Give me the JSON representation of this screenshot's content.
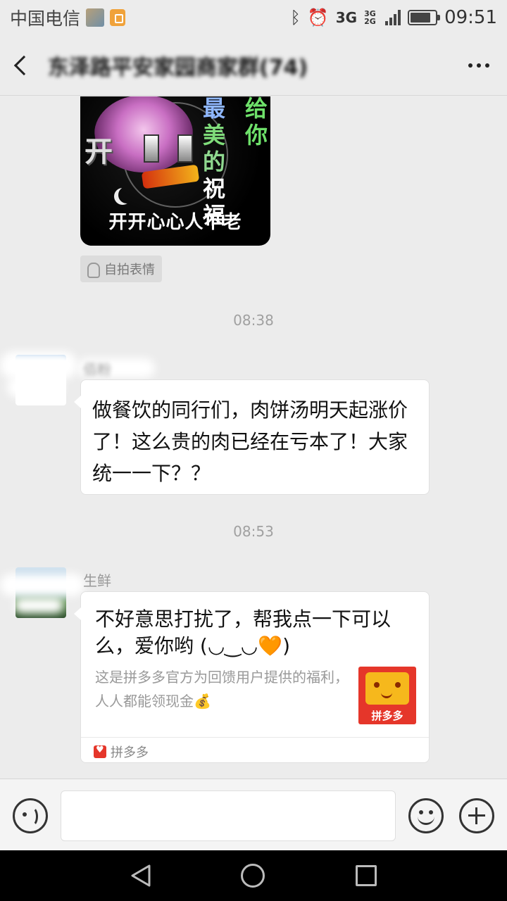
{
  "status_bar": {
    "carrier": "中国电信",
    "network": "3G",
    "network_secondary": "3G 2G",
    "time": "09:51"
  },
  "header": {
    "chat_title": "东泽路平安家园商家群(74)",
    "more_label": "..."
  },
  "messages": {
    "sticker": {
      "kai": "开",
      "col_main": [
        "最",
        "美",
        "的",
        "祝",
        "福"
      ],
      "col_side": [
        "给",
        "你"
      ],
      "caption": "开开心心人不老"
    },
    "selfie_tag": "自拍表情",
    "time_1": "08:38",
    "msg_1": {
      "sender": "佰粉",
      "text": "做餐饮的同行们，肉饼汤明天起涨价了！这么贵的肉已经在亏本了！大家统一一下？？"
    },
    "time_2": "08:53",
    "msg_2": {
      "sender": "生鲜",
      "card_title": "不好意思打扰了，帮我点一下可以么，爱你哟 (◡‿◡",
      "card_title_heart": "🧡",
      "card_title_end": ")",
      "card_desc": "这是拼多多官方为回馈用户提供的福利，人人都能领现金💰",
      "thumb_label": "拼多多",
      "source": "拼多多"
    }
  },
  "input_bar": {
    "icons": [
      "voice-icon",
      "emoji-icon",
      "plus-icon"
    ]
  },
  "nav_bar": {
    "icons": [
      "nav-back-icon",
      "nav-home-icon",
      "nav-recent-icon"
    ]
  },
  "colors": {
    "background": "#ececec",
    "bubble": "#ffffff",
    "timestamp": "#a0a0a0",
    "pdd_red": "#e5362a"
  }
}
